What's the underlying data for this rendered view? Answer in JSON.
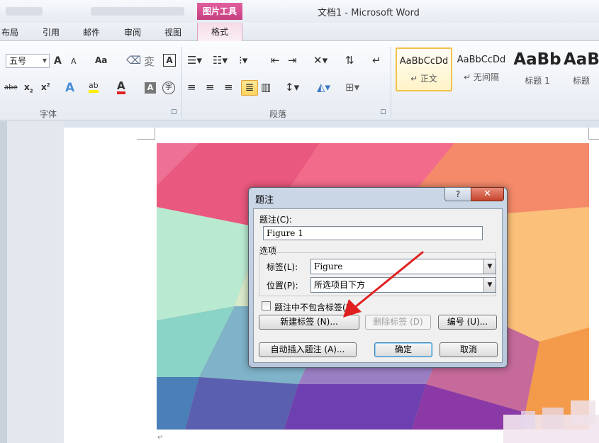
{
  "window": {
    "doc_title": "文档1 - Microsoft Word",
    "context_tab": "图片工具"
  },
  "tabs": {
    "layout": "布局",
    "references": "引用",
    "mailings": "邮件",
    "review": "审阅",
    "view": "视图",
    "format": "格式"
  },
  "ribbon": {
    "font_size": "五号",
    "grow_font": "A",
    "shrink_font": "A",
    "change_case": "Aa",
    "phonetic": "変",
    "char_border": "A",
    "strikethrough": "abe",
    "subscript": "x",
    "superscript": "x",
    "highlight_label": "ab",
    "font_color": "A",
    "char_shading": "A",
    "enclose_char": "字",
    "font_group": "字体",
    "paragraph_group": "段落",
    "styles": [
      {
        "sample": "AaBbCcDd",
        "name": "↵ 正文"
      },
      {
        "sample": "AaBbCcDd",
        "name": "↵ 无间隔"
      },
      {
        "sample": "AaBb",
        "name": "标题 1"
      },
      {
        "sample": "AaB",
        "name": "标题"
      }
    ]
  },
  "dialog": {
    "title": "题注",
    "help": "?",
    "close": "✕",
    "caption_label": "题注",
    "caption_key": "(C)",
    "caption_value": "Figure 1",
    "options_label": "选项",
    "label_label": "标签",
    "label_key": "(L)",
    "label_value": "Figure",
    "position_label": "位置",
    "position_key": "(P)",
    "position_value": "所选项目下方",
    "exclude_label": "题注中不包含标签",
    "exclude_key": "(E)",
    "exclude_checked": false,
    "new_label_button": "新建标签 (N)...",
    "delete_label_button": "删除标签 (D)",
    "numbering_button": "编号 (U)...",
    "autocaption_button": "自动插入题注 (A)...",
    "ok_button": "确定",
    "cancel_button": "取消"
  },
  "colors": {
    "context_tab": "#c63f81",
    "annotation_arrow": "#e02020",
    "dialog_frame": "#b9c8dc"
  }
}
